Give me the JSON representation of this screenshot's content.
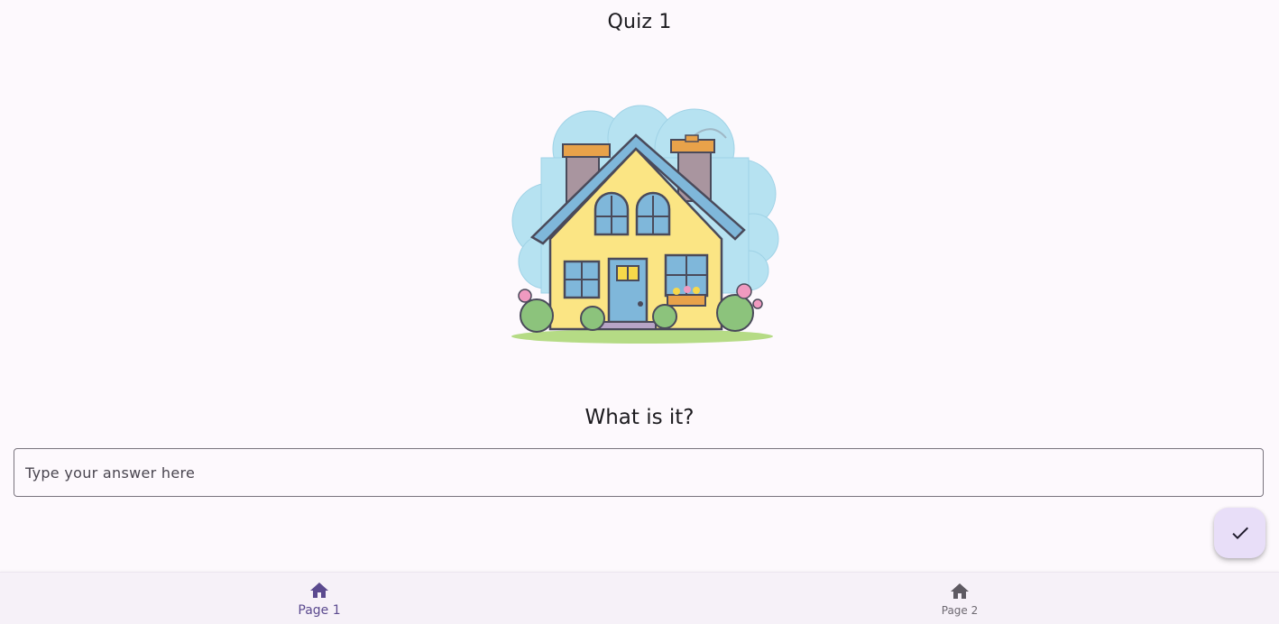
{
  "header": {
    "title": "Quiz 1"
  },
  "quiz": {
    "question": "What is it?",
    "answer": {
      "value": "",
      "placeholder": "Type your answer here"
    },
    "submit_icon": "check-icon"
  },
  "navigation": {
    "items": [
      {
        "label": "Page 1",
        "icon": "home-icon",
        "active": true
      },
      {
        "label": "Page 2",
        "icon": "home-icon",
        "active": false
      }
    ]
  },
  "colors": {
    "background": "#fdf9fd",
    "accent": "#5b4a8f",
    "fab": "#e8def8",
    "border": "#79747e"
  }
}
